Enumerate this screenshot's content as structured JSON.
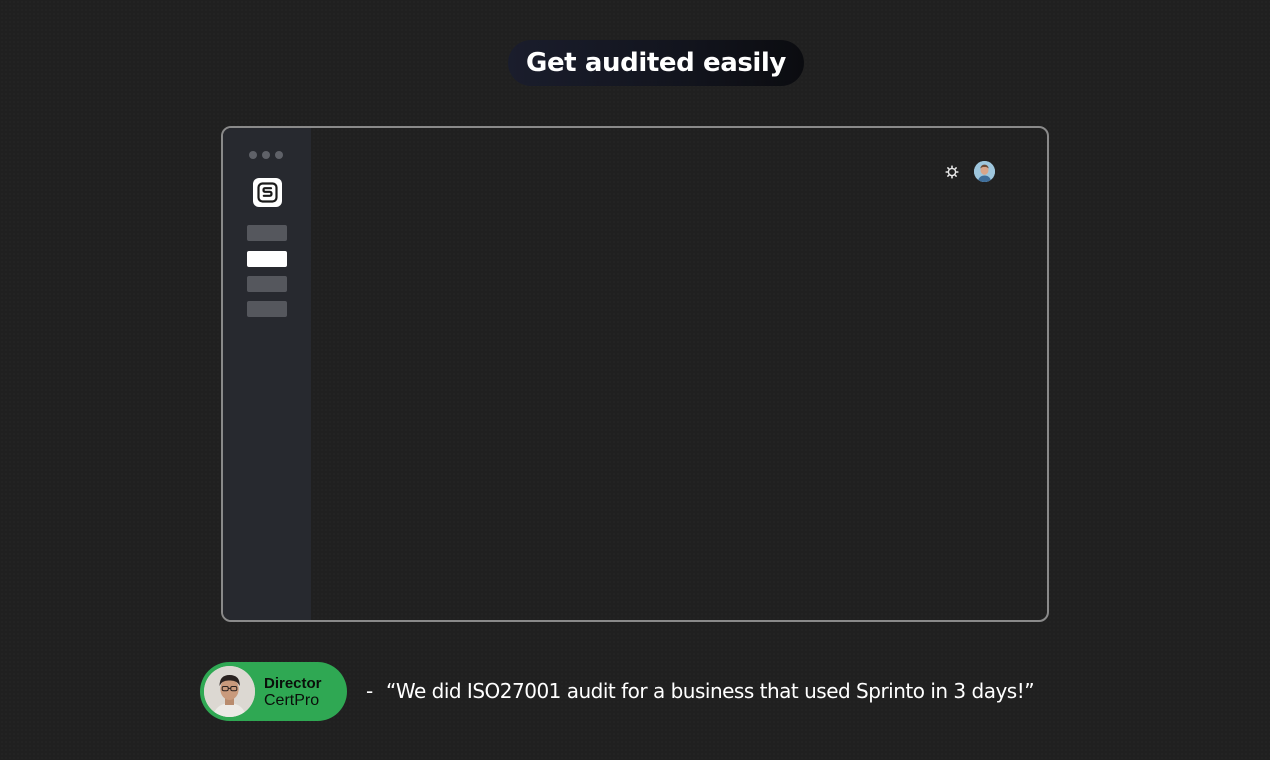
{
  "headline": {
    "text": "Get audited easily"
  },
  "app_window": {
    "window_controls": [
      "dot",
      "dot",
      "dot"
    ],
    "logo": {
      "letter": "S",
      "icon": "sprinto-logo-icon"
    },
    "sidebar": {
      "items": [
        {
          "state": "inactive"
        },
        {
          "state": "active"
        },
        {
          "state": "inactive"
        },
        {
          "state": "inactive"
        }
      ]
    },
    "header": {
      "settings_icon": "gear-icon",
      "avatar_icon": "user-avatar-icon"
    }
  },
  "testimonial": {
    "role": "Director",
    "company": "CertPro",
    "dash": "-",
    "quote": "“We did ISO27001 audit for a business that used Sprinto in 3 days!”",
    "pill_color": "#2fa853",
    "avatar_icon": "person-photo-icon"
  },
  "colors": {
    "background": "#202020",
    "sidebar": "#27292f",
    "window_border": "#8a8a8a",
    "accent_green": "#2fa853",
    "nav_inactive": "#55575d",
    "nav_active": "#ffffff"
  }
}
